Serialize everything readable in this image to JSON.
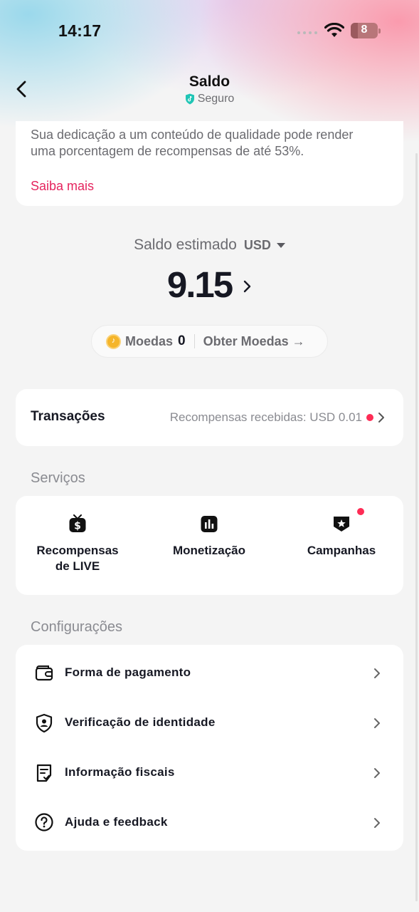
{
  "status_bar": {
    "time": "14:17",
    "battery": "8"
  },
  "header": {
    "title": "Saldo",
    "subtitle": "Seguro"
  },
  "info_card": {
    "text": "Sua dedicação a um conteúdo de qualidade pode render uma porcentagem de recompensas de até 53%.",
    "link": "Saiba mais"
  },
  "balance": {
    "label": "Saldo estimado",
    "currency": "USD",
    "amount": "9.15"
  },
  "coins": {
    "label": "Moedas",
    "value": "0",
    "get_label": "Obter Moedas",
    "arrow": "→"
  },
  "transactions": {
    "title": "Transações",
    "summary": "Recompensas recebidas: USD 0.01"
  },
  "services": {
    "title": "Serviços",
    "items": [
      {
        "label_line1": "Recompensas",
        "label_line2": "de LIVE",
        "icon": "dollar-tv-icon"
      },
      {
        "label_line1": "Monetização",
        "icon": "bar-chart-icon"
      },
      {
        "label_line1": "Campanhas",
        "icon": "star-shield-icon",
        "badge": true
      }
    ]
  },
  "settings": {
    "title": "Configurações",
    "items": [
      {
        "label": "Forma de pagamento",
        "icon": "wallet-icon"
      },
      {
        "label": "Verificação de identidade",
        "icon": "identity-shield-icon"
      },
      {
        "label": "Informação fiscais",
        "icon": "tax-document-icon"
      },
      {
        "label": "Ajuda e feedback",
        "icon": "help-icon"
      }
    ]
  },
  "colors": {
    "accent": "#fe2c55",
    "link": "#e5245e",
    "secure": "#20c5b5",
    "coin": "#f5b52a"
  }
}
